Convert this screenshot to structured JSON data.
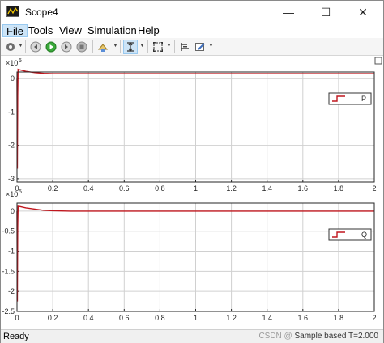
{
  "window": {
    "title": "Scope4",
    "minimize_glyph": "—",
    "maximize_glyph": "☐",
    "close_glyph": "✕"
  },
  "menu": {
    "items": [
      "File",
      "Tools",
      "View",
      "Simulation",
      "Help"
    ]
  },
  "toolbar": {
    "icons": [
      "settings-icon",
      "step-back-icon",
      "run-icon",
      "step-forward-icon",
      "stop-icon",
      "highlight-icon",
      "zoom-icon",
      "autoscale-icon",
      "cursor-measurements-icon",
      "style-icon"
    ]
  },
  "colors": {
    "signal": "#c0171e",
    "grid": "#d0d0d0",
    "axis": "#262626"
  },
  "chart_data": [
    {
      "type": "line",
      "exponent_label": "×10",
      "exponent": "5",
      "xlim": [
        0,
        2
      ],
      "ylim": [
        -3.1,
        0.2
      ],
      "x_ticks": [
        "0",
        "0.2",
        "0.4",
        "0.6",
        "0.8",
        "1",
        "1.2",
        "1.4",
        "1.6",
        "1.8",
        "2"
      ],
      "y_ticks": [
        "0",
        "-1",
        "-2",
        "-3"
      ],
      "legend_position": "right",
      "series": [
        {
          "name": "P",
          "x": [
            0,
            0.002,
            0.004,
            0.006,
            0.01,
            0.02,
            0.05,
            0.1,
            0.15,
            0.2,
            0.3,
            0.5,
            1.0,
            1.5,
            2.0
          ],
          "y": [
            0,
            -2.7,
            -0.5,
            0.28,
            0.27,
            0.26,
            0.22,
            0.18,
            0.16,
            0.15,
            0.15,
            0.15,
            0.15,
            0.15,
            0.15
          ]
        }
      ]
    },
    {
      "type": "line",
      "exponent_label": "×10",
      "exponent": "5",
      "xlim": [
        0,
        2
      ],
      "ylim": [
        -2.5,
        0.2
      ],
      "x_ticks": [
        "0",
        "0.2",
        "0.4",
        "0.6",
        "0.8",
        "1",
        "1.2",
        "1.4",
        "1.6",
        "1.8",
        "2"
      ],
      "y_ticks": [
        "0",
        "-0.5",
        "-1",
        "-1.5",
        "-2",
        "-2.5"
      ],
      "legend_position": "right",
      "series": [
        {
          "name": "Q",
          "x": [
            0,
            0.002,
            0.004,
            0.006,
            0.01,
            0.02,
            0.05,
            0.1,
            0.15,
            0.2,
            0.3,
            0.5,
            1.0,
            1.5,
            2.0
          ],
          "y": [
            0,
            -2.25,
            -0.4,
            0.12,
            0.12,
            0.11,
            0.08,
            0.05,
            0.02,
            0.01,
            0.0,
            0.0,
            0.0,
            0.0,
            0.0
          ]
        }
      ]
    }
  ],
  "status": {
    "left": "Ready",
    "watermark": "CSDN @",
    "right": "Sample based  T=2.000"
  }
}
